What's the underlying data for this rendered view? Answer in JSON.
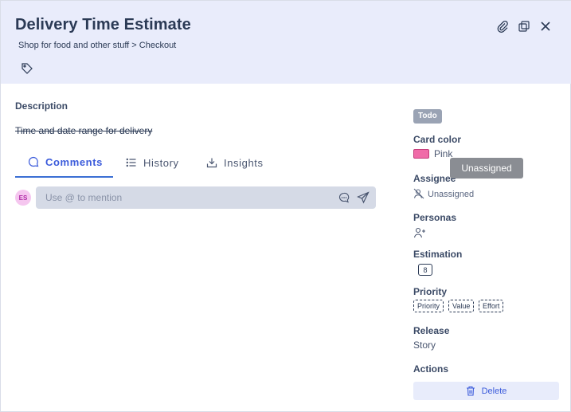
{
  "header": {
    "title": "Delivery Time Estimate",
    "breadcrumb": "Shop for food and other stuff > Checkout"
  },
  "description": {
    "label": "Description",
    "text": "Time and date range for delivery"
  },
  "tabs": [
    {
      "label": "Comments",
      "icon": "comment-icon",
      "active": true
    },
    {
      "label": "History",
      "icon": "list-icon",
      "active": false
    },
    {
      "label": "Insights",
      "icon": "download-tray-icon",
      "active": false
    }
  ],
  "comment": {
    "avatar_initials": "ES",
    "placeholder": "Use @ to mention"
  },
  "sidebar": {
    "status": "Todo",
    "card_color": {
      "label": "Card color",
      "value": "Pink",
      "swatch": "#f06ba8"
    },
    "tooltip": "Unassigned",
    "assignee": {
      "label": "Assignee",
      "value": "Unassigned"
    },
    "personas": {
      "label": "Personas"
    },
    "estimation": {
      "label": "Estimation",
      "value": "8"
    },
    "priority": {
      "label": "Priority",
      "chips": [
        "Priority",
        "Value",
        "Effort"
      ]
    },
    "release": {
      "label": "Release",
      "value": "Story"
    },
    "actions": {
      "label": "Actions",
      "delete_label": "Delete"
    }
  },
  "colors": {
    "header_bg": "#e9ecfb",
    "accent": "#3b5bdb",
    "status_badge": "#9aa3b4"
  }
}
